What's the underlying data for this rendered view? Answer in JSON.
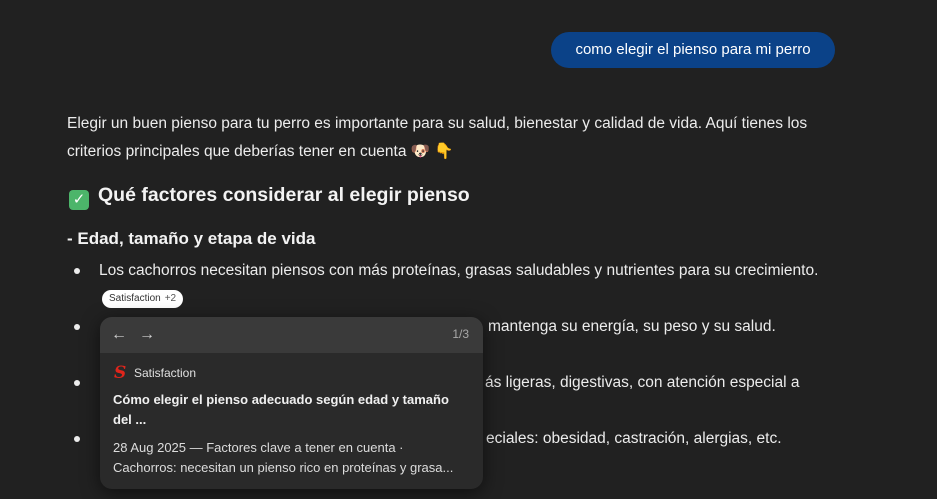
{
  "user_message": "como elegir el pienso para mi perro",
  "intro_line1": "Elegir un buen pienso para tu perro es importante para su salud, bienestar y calidad de vida. Aquí tienes los",
  "intro_line2": "criterios principales que deberías tener en cuenta 🐶 👇",
  "heading_icon": "✅",
  "heading": "Qué factores considerar al elegir pienso",
  "subheading": "- Edad, tamaño y etapa de vida",
  "bullets": [
    "Los cachorros necesitan piensos con más proteínas, grasas saludables y nutrientes para su crecimiento.",
    "mantenga su energía, su peso y su salud.",
    "ás ligeras, digestivas, con atención especial a",
    "eciales: obesidad, castración, alergias, etc."
  ],
  "citation_chip": {
    "label": "Satisfaction",
    "count": "+2"
  },
  "popover": {
    "prev_icon": "←",
    "next_icon": "→",
    "pager": "1/3",
    "source_logo": "S",
    "source_name": "Satisfaction",
    "title_line1": "Cómo elegir el pienso adecuado según edad y tamaño",
    "title_line2": "del ...",
    "snippet_line1": "28 Aug 2025 — Factores clave a tener en cuenta ·",
    "snippet_line2": "Cachorros: necesitan un pienso rico en proteínas y grasa..."
  },
  "colors": {
    "background": "#212121",
    "user_bubble": "#0b4288",
    "popover": "#2a2a2a",
    "popover_header": "#3a3a3a",
    "source_logo": "#e1251b",
    "check": "#4cb56a"
  }
}
